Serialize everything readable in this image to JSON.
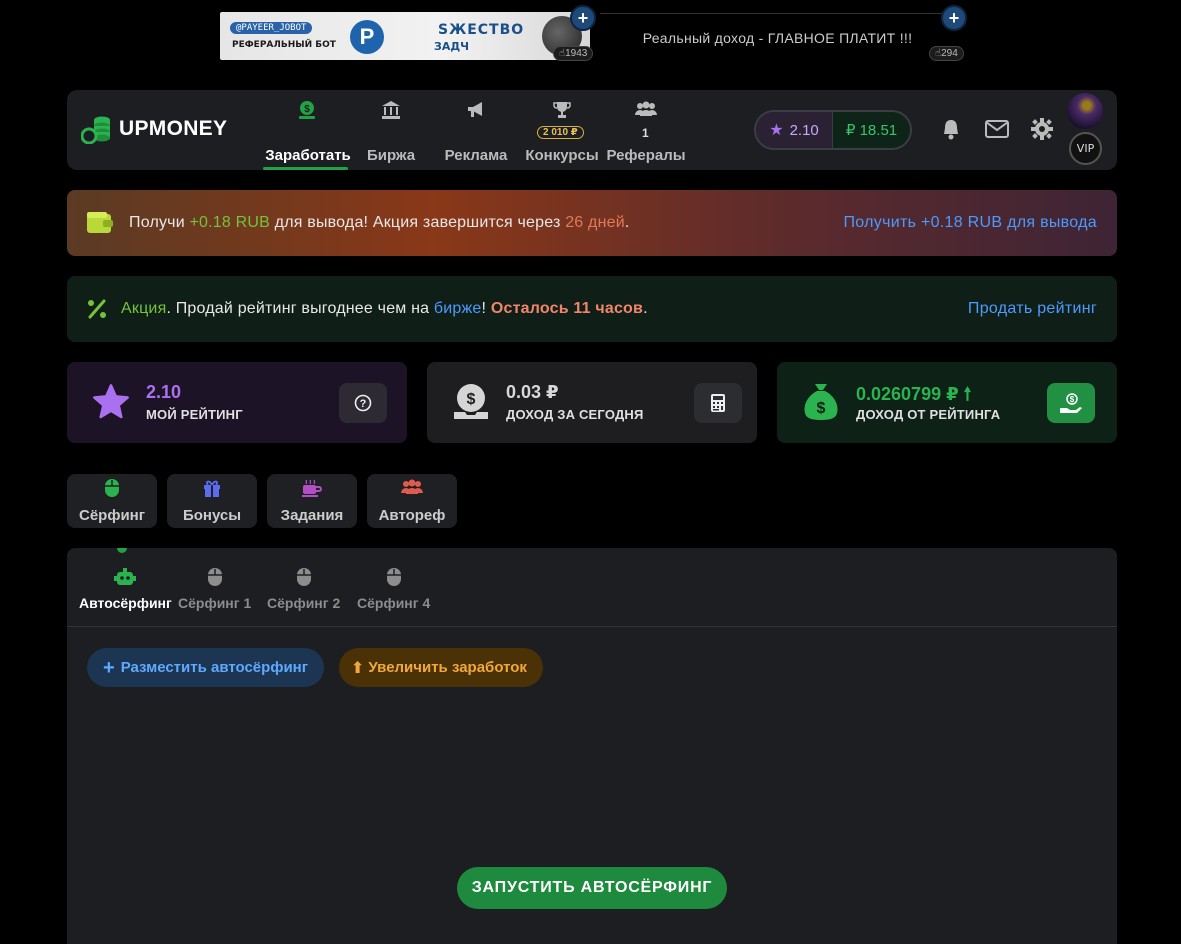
{
  "ad": {
    "bot_tag": "@PAYEER_JOBOT",
    "bot_sub": "РЕФЕРАЛЬНЫЙ БОТ",
    "p_letter": "P",
    "word1": "SЖЕСТВО",
    "word2": "ЗАДЧ",
    "count1": "1943",
    "text": "Реальный доход - ГЛАВНОЕ ПЛАТИТ !!!",
    "count2": "294",
    "plus": "+"
  },
  "header": {
    "logo": "UPMONEY",
    "nav": [
      {
        "label": "Заработать",
        "icon": "money-icon",
        "active": true
      },
      {
        "label": "Биржа",
        "icon": "bank-icon"
      },
      {
        "label": "Реклама",
        "icon": "megaphone-icon"
      },
      {
        "label": "Конкурсы",
        "icon": "trophy-icon",
        "badge": "2 010 ₽"
      },
      {
        "label": "Рефералы",
        "icon": "users-icon",
        "count": "1"
      }
    ],
    "rating": "2.10",
    "balance": "₽ 18.51",
    "vip": "VIP"
  },
  "promo1": {
    "t1": "Получи ",
    "amount": "+0.18 RUB",
    "t2": " для вывода! Акция завершится через ",
    "days": "26 дней",
    "t3": ".",
    "link": "Получить +0.18 RUB для вывода"
  },
  "promo2": {
    "action": "Акция",
    "t1": ". Продай рейтинг выгоднее чем на ",
    "exchange": "бирже",
    "t2": "! ",
    "left": "Осталось 11 часов",
    "t3": ".",
    "link": "Продать рейтинг"
  },
  "cards": {
    "rating": {
      "value": "2.10",
      "label": "МОЙ РЕЙТИНГ"
    },
    "today": {
      "value": "0.03 ₽",
      "label": "ДОХОД ЗА СЕГОДНЯ"
    },
    "from_rating": {
      "value": "0.0260799 ₽",
      "label": "ДОХОД ОТ РЕЙТИНГА"
    }
  },
  "categories": [
    "Сёрфинг",
    "Бонусы",
    "Задания",
    "Автореф"
  ],
  "sub_tabs": [
    "Автосёрфинг",
    "Сёрфинг 1",
    "Сёрфинг 2",
    "Сёрфинг 4"
  ],
  "buttons": {
    "place": "Разместить автосёрфинг",
    "earn": "Увеличить заработок",
    "start": "ЗАПУСТИТЬ АВТОСЁРФИНГ"
  },
  "colors": {
    "accent_green": "#21a345",
    "link_blue": "#4b9bff",
    "rating_purple": "#a970f0"
  }
}
